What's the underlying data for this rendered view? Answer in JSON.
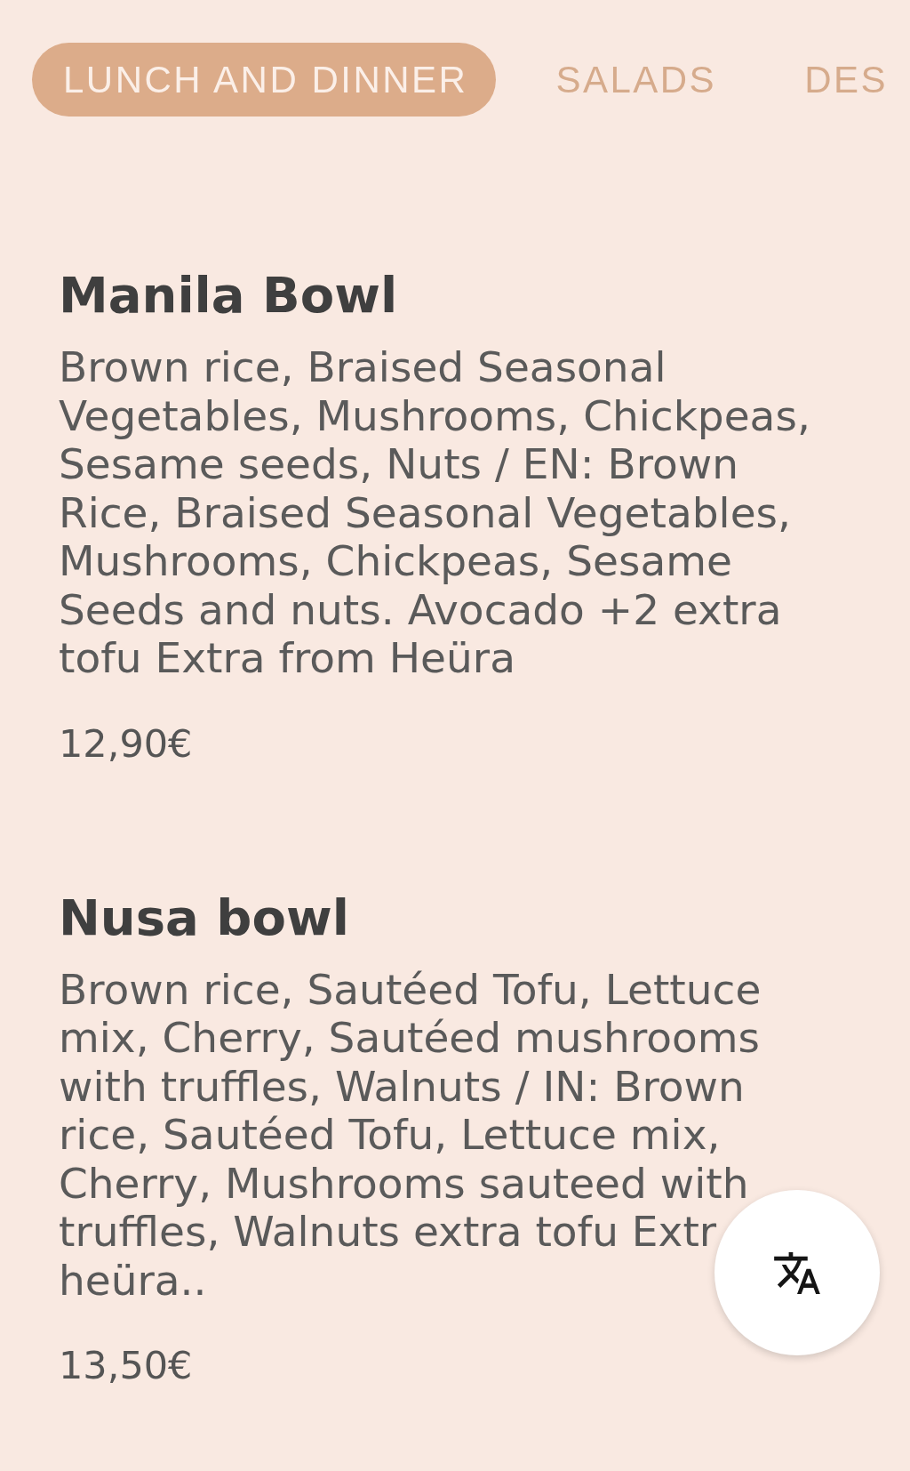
{
  "tabs": [
    {
      "label": "LUNCH AND DINNER",
      "selected": true
    },
    {
      "label": "SALADS",
      "selected": false
    },
    {
      "label": "DES",
      "selected": false
    }
  ],
  "dishes": [
    {
      "name": "Manila Bowl",
      "description": "Brown rice, Braised Seasonal Vegetables, Mushrooms, Chickpeas, Sesame seeds, Nuts / EN: Brown Rice, Braised Seasonal Vegetables, Mushrooms, Chickpeas, Sesame Seeds and nuts. Avocado +2 extra tofu Extra from Heüra",
      "price": "12,90€"
    },
    {
      "name": "Nusa bowl",
      "description": "Brown rice, Sautéed Tofu, Lettuce mix, Cherry, Sautéed mushrooms with truffles, Walnuts / IN: Brown rice, Sautéed Tofu, Lettuce mix, Cherry, Mushrooms sauteed with truffles, Walnuts extra tofu Extr heüra..",
      "price": "13,50€"
    }
  ]
}
